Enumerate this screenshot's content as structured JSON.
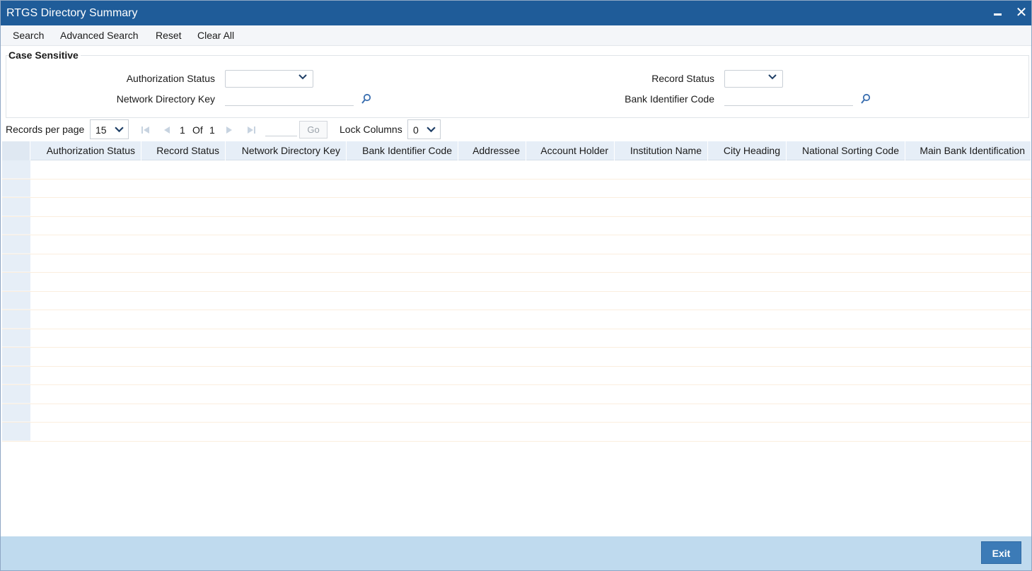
{
  "window": {
    "title": "RTGS Directory Summary",
    "minimize_icon": "minimize-icon",
    "close_icon": "close-icon"
  },
  "menu": [
    "Search",
    "Advanced Search",
    "Reset",
    "Clear All"
  ],
  "criteria": {
    "legend": "Case Sensitive",
    "authorization_status": {
      "label": "Authorization Status",
      "value": ""
    },
    "record_status": {
      "label": "Record Status",
      "value": ""
    },
    "network_directory_key": {
      "label": "Network Directory Key",
      "value": ""
    },
    "bank_identifier_code": {
      "label": "Bank Identifier Code",
      "value": ""
    },
    "lookup_icon": "search-lookup-icon"
  },
  "pager": {
    "records_label": "Records per page",
    "records_value": "15",
    "current_page": "1",
    "of_label": "Of",
    "total_pages": "1",
    "go_label": "Go",
    "lock_label": "Lock Columns",
    "lock_value": "0"
  },
  "grid": {
    "columns": [
      "Authorization Status",
      "Record Status",
      "Network Directory Key",
      "Bank Identifier Code",
      "Addressee",
      "Account Holder",
      "Institution Name",
      "City Heading",
      "National Sorting Code",
      "Main Bank Identification"
    ],
    "rows": []
  },
  "footer": {
    "exit_label": "Exit"
  }
}
